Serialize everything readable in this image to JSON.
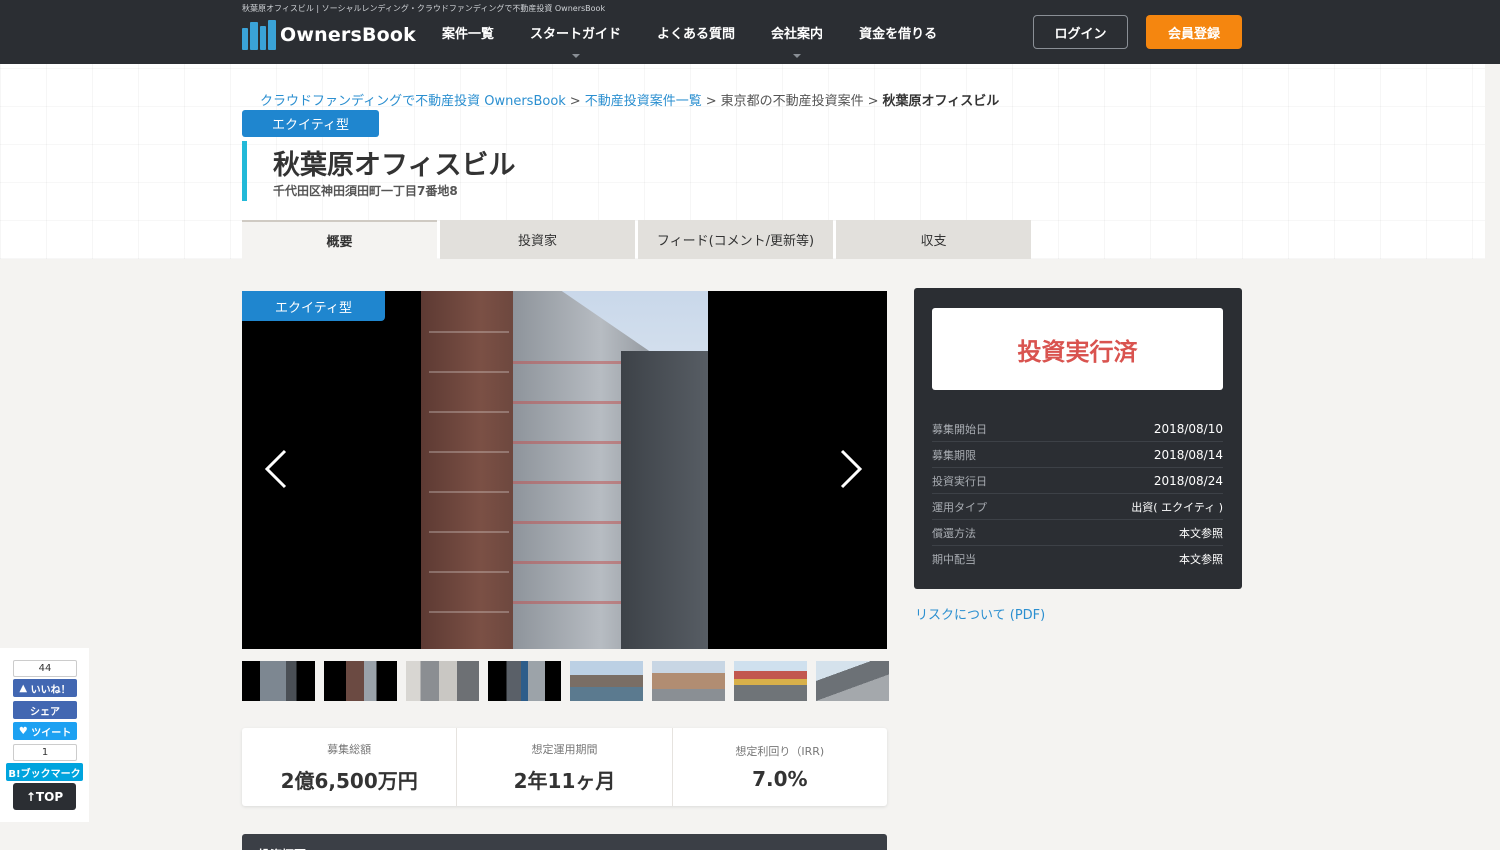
{
  "header": {
    "page_caption": "秋葉原オフィスビル | ソーシャルレンディング・クラウドファンディングで不動産投資 OwnersBook",
    "logo_text": "OwnersBook",
    "nav": [
      {
        "label": "案件一覧",
        "has_dropdown": false
      },
      {
        "label": "スタートガイド",
        "has_dropdown": true
      },
      {
        "label": "よくある質問",
        "has_dropdown": false
      },
      {
        "label": "会社案内",
        "has_dropdown": true
      },
      {
        "label": "資金を借りる",
        "has_dropdown": false
      }
    ],
    "login_label": "ログイン",
    "register_label": "会員登録",
    "colors": {
      "bar": "#2b2e33",
      "register": "#f5860f",
      "logo": "#3aa3d8"
    }
  },
  "breadcrumb": {
    "home": "クラウドファンディングで不動産投資 OwnersBook",
    "list": "不動産投資案件一覧",
    "region": "東京都の不動産投資案件",
    "current": "秋葉原オフィスビル",
    "separator": ">"
  },
  "property": {
    "type_badge": "エクイティ型",
    "title": "秋葉原オフィスビル",
    "address": "千代田区神田須田町一丁目7番地8"
  },
  "tabs": [
    {
      "label": "概要",
      "active": true
    },
    {
      "label": "投資家",
      "active": false
    },
    {
      "label": "フィード(コメント/更新等)",
      "active": false
    },
    {
      "label": "収支",
      "active": false
    }
  ],
  "gallery": {
    "badge": "エクイティ型",
    "prev_icon": "chevron-left-icon",
    "next_icon": "chevron-right-icon",
    "thumbnail_count": 8
  },
  "stats": [
    {
      "label": "募集総額",
      "value": "2億6,500万円"
    },
    {
      "label": "想定運用期間",
      "value": "2年11ヶ月"
    },
    {
      "label": "想定利回り（IRR)",
      "value": "7.0%"
    }
  ],
  "section_heading": "投資概要",
  "panel": {
    "status": "投資実行済",
    "status_color": "#d9534f",
    "rows": [
      {
        "label": "募集開始日",
        "value": "2018/08/10"
      },
      {
        "label": "募集期限",
        "value": "2018/08/14"
      },
      {
        "label": "投資実行日",
        "value": "2018/08/24"
      },
      {
        "label": "運用タイプ",
        "value": "出資( エクイティ )"
      },
      {
        "label": "償還方法",
        "value": "本文参照"
      },
      {
        "label": "期中配当",
        "value": "本文参照"
      }
    ]
  },
  "risk_link": "リスクについて (PDF)",
  "social": {
    "like_count": "44",
    "like_label": "いいね！",
    "share_label": "シェア",
    "tweet_label": "ツイート",
    "hatena_count": "1",
    "hatena_label": "B!ブックマーク",
    "top_label": "↑TOP",
    "colors": {
      "facebook": "#4267b2",
      "twitter": "#1da1f2",
      "hatena": "#00a4de"
    }
  }
}
